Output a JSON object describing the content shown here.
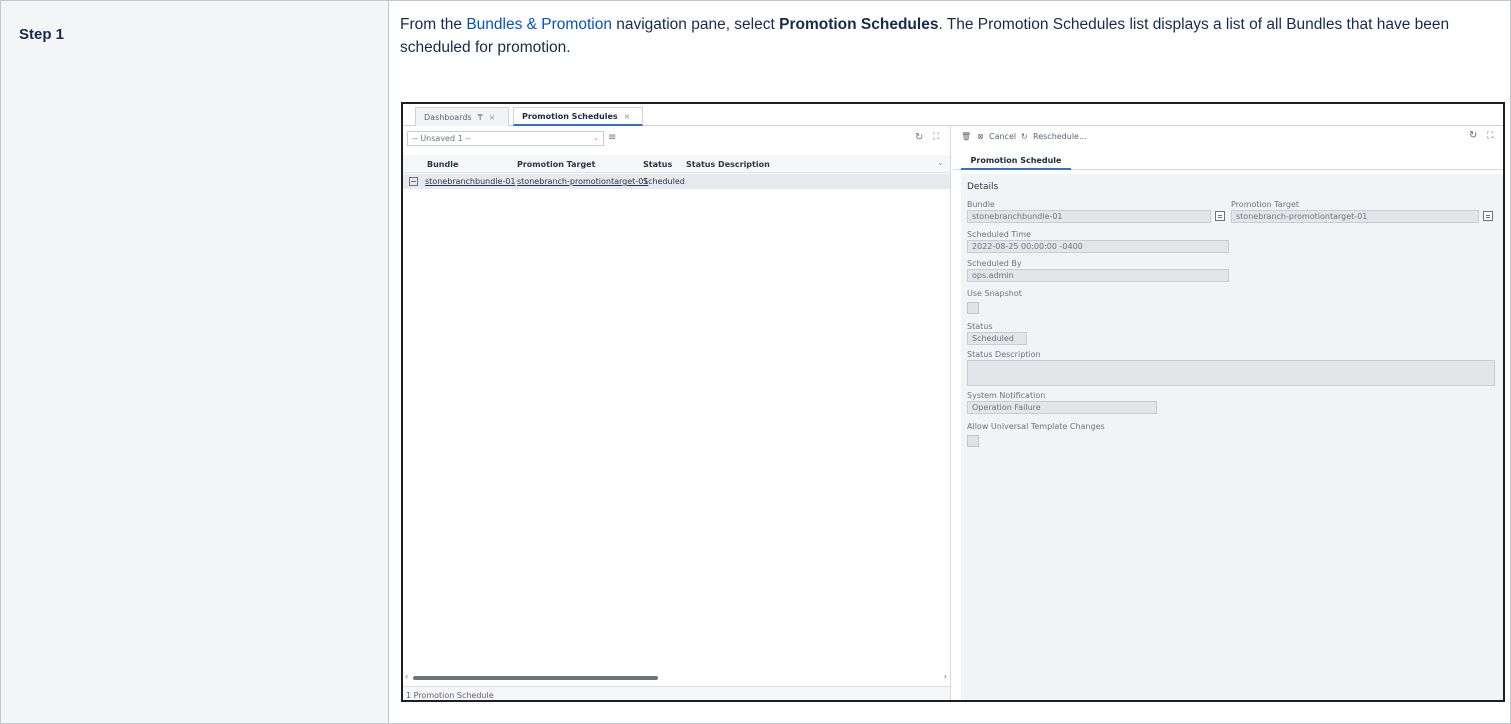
{
  "step": {
    "label": "Step 1"
  },
  "instruction": {
    "prefix": "From the ",
    "link": "Bundles & Promotion",
    "middle": " navigation pane, select ",
    "bold": "Promotion Schedules",
    "suffix": ". The Promotion Schedules list displays a list of all Bundles that have been scheduled for promotion."
  },
  "app": {
    "tabs": [
      {
        "label": "Dashboards",
        "pin_icon": "₸",
        "close": "×"
      },
      {
        "label": "Promotion Schedules",
        "close": "×"
      }
    ],
    "list": {
      "filter_value": "-- Unsaved 1 --",
      "filter_icon": "filter-icon",
      "columns": [
        "Bundle",
        "Promotion Target",
        "Status",
        "Status Description"
      ],
      "rows": [
        {
          "bundle": "stonebranchbundle-01",
          "target": "stonebranch-promotiontarget-01",
          "status": "Scheduled",
          "description": ""
        }
      ],
      "footer": "1 Promotion Schedule"
    },
    "detail": {
      "toolbar": {
        "cancel": "Cancel",
        "reschedule": "Reschedule..."
      },
      "tab": "Promotion Schedule",
      "section": "Details",
      "bundle_label": "Bundle",
      "bundle_value": "stonebranchbundle-01",
      "target_label": "Promotion Target",
      "target_value": "stonebranch-promotiontarget-01",
      "scheduled_time_label": "Scheduled Time",
      "scheduled_time_value": "2022-08-25 00:00:00 -0400",
      "scheduled_by_label": "Scheduled By",
      "scheduled_by_value": "ops.admin",
      "use_snapshot_label": "Use Snapshot",
      "use_snapshot_checked": false,
      "status_label": "Status",
      "status_value": "Scheduled",
      "status_desc_label": "Status Description",
      "status_desc_value": "",
      "sys_notif_label": "System Notification",
      "sys_notif_value": "Operation Failure",
      "allow_label": "Allow Universal Template Changes",
      "allow_checked": false
    }
  },
  "colors": {
    "link": "#0052cc",
    "accent": "#2d73c9"
  }
}
